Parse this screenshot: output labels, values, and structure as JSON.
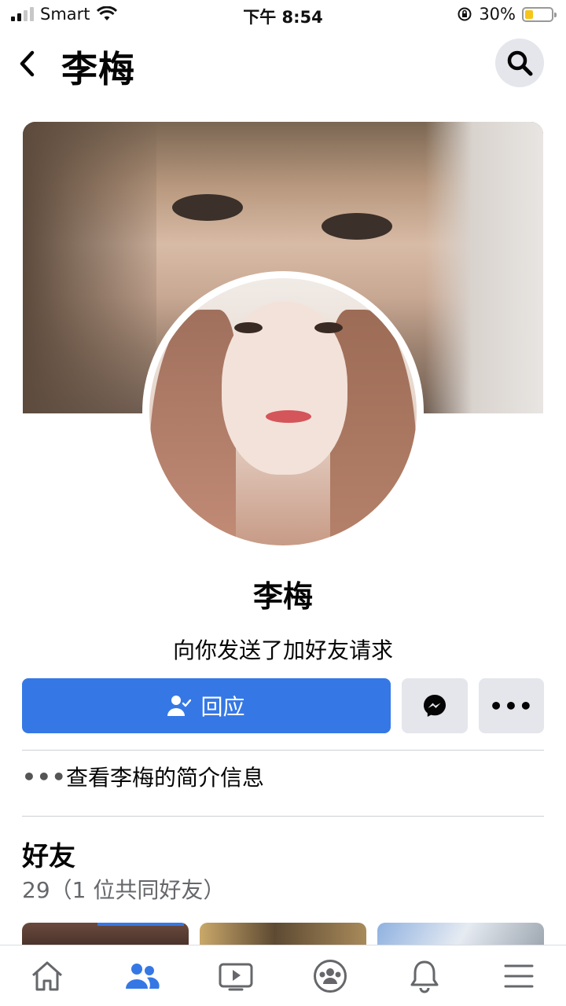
{
  "status_bar": {
    "carrier": "Smart",
    "time": "下午 8:54",
    "battery_percent": "30%",
    "battery_level": 0.3
  },
  "header": {
    "title": "李梅",
    "back_icon": "chevron-left-icon",
    "search_icon": "search-icon"
  },
  "profile": {
    "name": "李梅",
    "request_text": "向你发送了加好友请求"
  },
  "actions": {
    "respond_label": "回应",
    "more_label": "•••"
  },
  "about": {
    "dots": "•••",
    "label": "查看李梅的简介信息"
  },
  "friends": {
    "title": "好友",
    "count_text": "29（1 位共同好友）"
  },
  "tabs": [
    {
      "name": "home",
      "icon": "home-icon",
      "active": false
    },
    {
      "name": "friends",
      "icon": "friends-icon",
      "active": true
    },
    {
      "name": "watch",
      "icon": "video-icon",
      "active": false
    },
    {
      "name": "groups",
      "icon": "groups-icon",
      "active": false
    },
    {
      "name": "notifications",
      "icon": "bell-icon",
      "active": false
    },
    {
      "name": "menu",
      "icon": "menu-icon",
      "active": false
    }
  ],
  "colors": {
    "accent": "#3578e5",
    "button_gray": "#e4e6eb",
    "secondary_text": "#65676b"
  }
}
